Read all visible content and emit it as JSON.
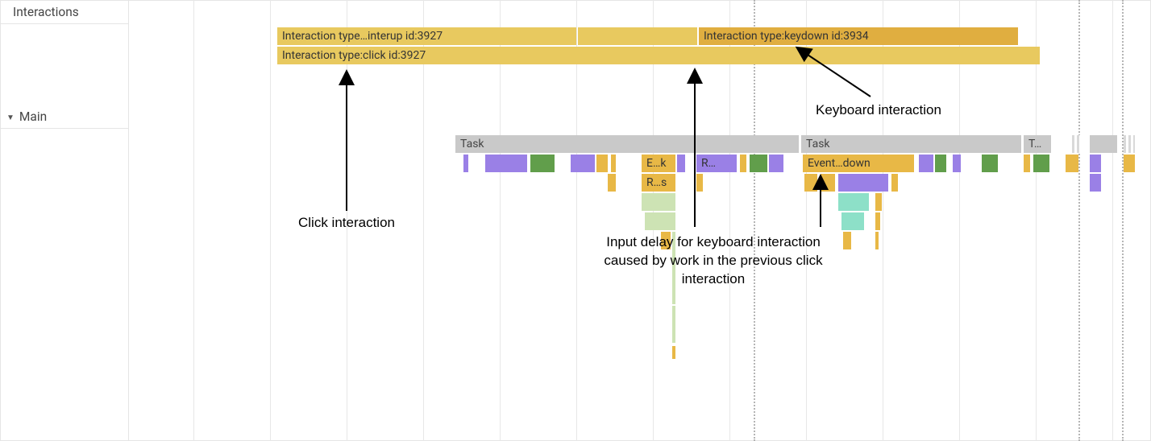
{
  "tracks": {
    "interactions_label": "Interactions",
    "main_label": "Main",
    "disclosure_glyph": "▼"
  },
  "interactions": {
    "row1": {
      "label": "Interaction type…interup id:3927"
    },
    "row1_keydown": {
      "label": "Interaction type:keydown id:3934"
    },
    "row2": {
      "label": "Interaction type:click id:3927"
    }
  },
  "main": {
    "task1_label": "Task",
    "task2_label": "Task",
    "task3_label": "T…",
    "event_ek": "E…k",
    "event_r": "R…",
    "event_rs": "R…s",
    "event_down": "Event…down"
  },
  "annotations": {
    "click": "Click interaction",
    "keyboard": "Keyboard interaction",
    "delay": "Input delay for keyboard interaction caused by work in the previous click interaction"
  },
  "colors": {
    "interaction_yellow": "#e8c95f",
    "interaction_ochre": "#e0ae40",
    "task_gray": "#c9c9c9",
    "event_orange": "#e8b846",
    "event_purple": "#9a80e6",
    "event_green": "#619e4b",
    "event_lightgreen": "#cde3b4",
    "event_teal": "#8de0c8",
    "grid": "#e7e7e7",
    "dotted_marker": "#b5b5b5"
  }
}
